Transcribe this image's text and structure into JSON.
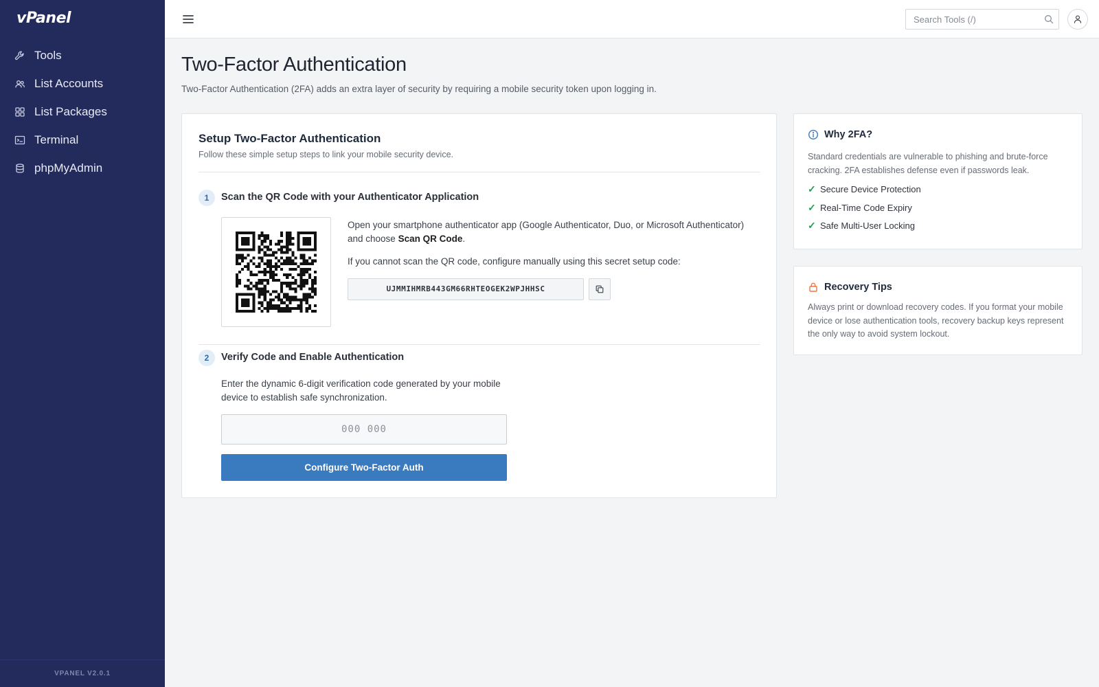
{
  "sidebar": {
    "logo": "vPanel",
    "items": [
      {
        "label": "Tools",
        "icon": "wrench-icon"
      },
      {
        "label": "List Accounts",
        "icon": "users-icon"
      },
      {
        "label": "List Packages",
        "icon": "grid-icon"
      },
      {
        "label": "Terminal",
        "icon": "terminal-icon"
      },
      {
        "label": "phpMyAdmin",
        "icon": "database-icon"
      }
    ],
    "footer": "VPANEL V2.0.1"
  },
  "topbar": {
    "menu_icon": "hamburger-icon",
    "search_placeholder": "Search Tools (/)",
    "search_icon": "search-icon",
    "user_icon": "user-icon"
  },
  "page": {
    "title": "Two-Factor Authentication",
    "description": "Two-Factor Authentication (2FA) adds an extra layer of security by requiring a mobile security token upon logging in."
  },
  "setup": {
    "title": "Setup Two-Factor Authentication",
    "subtitle": "Follow these simple setup steps to link your mobile security device.",
    "step1": {
      "number": "1",
      "title": "Scan the QR Code with your Authenticator Application",
      "text_before": "Open your smartphone authenticator app (Google Authenticator, Duo, or Microsoft Authenticator) and choose ",
      "text_bold": "Scan QR Code",
      "text_after": ".",
      "manual_text": "If you cannot scan the QR code, configure manually using this secret setup code:",
      "secret": "UJMMIHMRB443GM66RHTEOGEK2WPJHHSC",
      "copy_icon": "copy-icon"
    },
    "step2": {
      "number": "2",
      "title": "Verify Code and Enable Authentication",
      "text": "Enter the dynamic 6-digit verification code generated by your mobile device to establish safe synchronization.",
      "input_placeholder": "000 000",
      "button_label": "Configure Two-Factor Auth"
    }
  },
  "why": {
    "title": "Why 2FA?",
    "icon": "info-icon",
    "body": "Standard credentials are vulnerable to phishing and brute-force cracking. 2FA establishes defense even if passwords leak.",
    "items": [
      "Secure Device Protection",
      "Real-Time Code Expiry",
      "Safe Multi-User Locking"
    ],
    "check_symbol": "✓"
  },
  "recovery": {
    "title": "Recovery Tips",
    "icon": "lock-icon",
    "body": "Always print or download recovery codes. If you format your mobile device or lose authentication tools, recovery backup keys represent the only way to avoid system lockout."
  },
  "colors": {
    "sidebar_bg": "#232a5c",
    "primary_button": "#3a7abf",
    "check_green": "#1f9d55",
    "lock_orange": "#f0743e",
    "info_blue": "#3a7abf"
  }
}
